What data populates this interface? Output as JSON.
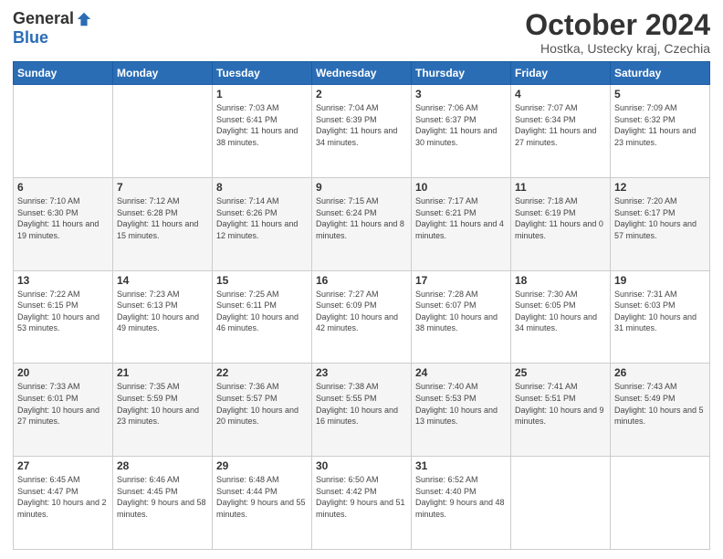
{
  "logo": {
    "general": "General",
    "blue": "Blue"
  },
  "header": {
    "title": "October 2024",
    "location": "Hostka, Ustecky kraj, Czechia"
  },
  "weekdays": [
    "Sunday",
    "Monday",
    "Tuesday",
    "Wednesday",
    "Thursday",
    "Friday",
    "Saturday"
  ],
  "weeks": [
    [
      {
        "day": "",
        "info": ""
      },
      {
        "day": "",
        "info": ""
      },
      {
        "day": "1",
        "info": "Sunrise: 7:03 AM\nSunset: 6:41 PM\nDaylight: 11 hours and 38 minutes."
      },
      {
        "day": "2",
        "info": "Sunrise: 7:04 AM\nSunset: 6:39 PM\nDaylight: 11 hours and 34 minutes."
      },
      {
        "day": "3",
        "info": "Sunrise: 7:06 AM\nSunset: 6:37 PM\nDaylight: 11 hours and 30 minutes."
      },
      {
        "day": "4",
        "info": "Sunrise: 7:07 AM\nSunset: 6:34 PM\nDaylight: 11 hours and 27 minutes."
      },
      {
        "day": "5",
        "info": "Sunrise: 7:09 AM\nSunset: 6:32 PM\nDaylight: 11 hours and 23 minutes."
      }
    ],
    [
      {
        "day": "6",
        "info": "Sunrise: 7:10 AM\nSunset: 6:30 PM\nDaylight: 11 hours and 19 minutes."
      },
      {
        "day": "7",
        "info": "Sunrise: 7:12 AM\nSunset: 6:28 PM\nDaylight: 11 hours and 15 minutes."
      },
      {
        "day": "8",
        "info": "Sunrise: 7:14 AM\nSunset: 6:26 PM\nDaylight: 11 hours and 12 minutes."
      },
      {
        "day": "9",
        "info": "Sunrise: 7:15 AM\nSunset: 6:24 PM\nDaylight: 11 hours and 8 minutes."
      },
      {
        "day": "10",
        "info": "Sunrise: 7:17 AM\nSunset: 6:21 PM\nDaylight: 11 hours and 4 minutes."
      },
      {
        "day": "11",
        "info": "Sunrise: 7:18 AM\nSunset: 6:19 PM\nDaylight: 11 hours and 0 minutes."
      },
      {
        "day": "12",
        "info": "Sunrise: 7:20 AM\nSunset: 6:17 PM\nDaylight: 10 hours and 57 minutes."
      }
    ],
    [
      {
        "day": "13",
        "info": "Sunrise: 7:22 AM\nSunset: 6:15 PM\nDaylight: 10 hours and 53 minutes."
      },
      {
        "day": "14",
        "info": "Sunrise: 7:23 AM\nSunset: 6:13 PM\nDaylight: 10 hours and 49 minutes."
      },
      {
        "day": "15",
        "info": "Sunrise: 7:25 AM\nSunset: 6:11 PM\nDaylight: 10 hours and 46 minutes."
      },
      {
        "day": "16",
        "info": "Sunrise: 7:27 AM\nSunset: 6:09 PM\nDaylight: 10 hours and 42 minutes."
      },
      {
        "day": "17",
        "info": "Sunrise: 7:28 AM\nSunset: 6:07 PM\nDaylight: 10 hours and 38 minutes."
      },
      {
        "day": "18",
        "info": "Sunrise: 7:30 AM\nSunset: 6:05 PM\nDaylight: 10 hours and 34 minutes."
      },
      {
        "day": "19",
        "info": "Sunrise: 7:31 AM\nSunset: 6:03 PM\nDaylight: 10 hours and 31 minutes."
      }
    ],
    [
      {
        "day": "20",
        "info": "Sunrise: 7:33 AM\nSunset: 6:01 PM\nDaylight: 10 hours and 27 minutes."
      },
      {
        "day": "21",
        "info": "Sunrise: 7:35 AM\nSunset: 5:59 PM\nDaylight: 10 hours and 23 minutes."
      },
      {
        "day": "22",
        "info": "Sunrise: 7:36 AM\nSunset: 5:57 PM\nDaylight: 10 hours and 20 minutes."
      },
      {
        "day": "23",
        "info": "Sunrise: 7:38 AM\nSunset: 5:55 PM\nDaylight: 10 hours and 16 minutes."
      },
      {
        "day": "24",
        "info": "Sunrise: 7:40 AM\nSunset: 5:53 PM\nDaylight: 10 hours and 13 minutes."
      },
      {
        "day": "25",
        "info": "Sunrise: 7:41 AM\nSunset: 5:51 PM\nDaylight: 10 hours and 9 minutes."
      },
      {
        "day": "26",
        "info": "Sunrise: 7:43 AM\nSunset: 5:49 PM\nDaylight: 10 hours and 5 minutes."
      }
    ],
    [
      {
        "day": "27",
        "info": "Sunrise: 6:45 AM\nSunset: 4:47 PM\nDaylight: 10 hours and 2 minutes."
      },
      {
        "day": "28",
        "info": "Sunrise: 6:46 AM\nSunset: 4:45 PM\nDaylight: 9 hours and 58 minutes."
      },
      {
        "day": "29",
        "info": "Sunrise: 6:48 AM\nSunset: 4:44 PM\nDaylight: 9 hours and 55 minutes."
      },
      {
        "day": "30",
        "info": "Sunrise: 6:50 AM\nSunset: 4:42 PM\nDaylight: 9 hours and 51 minutes."
      },
      {
        "day": "31",
        "info": "Sunrise: 6:52 AM\nSunset: 4:40 PM\nDaylight: 9 hours and 48 minutes."
      },
      {
        "day": "",
        "info": ""
      },
      {
        "day": "",
        "info": ""
      }
    ]
  ]
}
